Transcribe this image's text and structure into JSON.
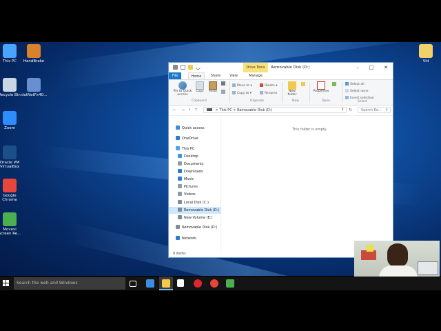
{
  "desktop": {
    "icons_left": [
      {
        "label": "This PC",
        "icon": "this-pc-icon",
        "color": "#4aa3ff"
      },
      {
        "label": "Recycle Bin",
        "icon": "recycle-bin-icon",
        "color": "#c9d6e3"
      },
      {
        "label": "Zoom",
        "icon": "zoom-icon",
        "color": "#2d8cff"
      },
      {
        "label": "Oracle VM VirtualBox",
        "icon": "virtualbox-icon",
        "color": "#1b4f8a"
      },
      {
        "label": "Google Chrome",
        "icon": "chrome-icon",
        "color": "#e8453c"
      },
      {
        "label": "Movavi Screen Re...",
        "icon": "movavi-icon",
        "color": "#4caf50"
      }
    ],
    "icons_second": [
      {
        "label": "HandBrake",
        "icon": "handbrake-icon",
        "color": "#d9822b"
      },
      {
        "label": "dotNetFx40...",
        "icon": "installer-icon",
        "color": "#6a8fd1"
      }
    ],
    "icon_right": {
      "label": "Vid",
      "icon": "folder-icon",
      "color": "#f2d16b"
    }
  },
  "explorer": {
    "context_tab": "Drive Tools",
    "title": "Removable Disk (D:)",
    "tabs": [
      "File",
      "Home",
      "Share",
      "View",
      "Manage"
    ],
    "ribbon": {
      "pin_label": "Pin to Quick access",
      "copy_label": "Copy",
      "paste_label": "Paste",
      "clipboard_group": "Clipboard",
      "move_to": "Move to",
      "copy_to": "Copy to",
      "delete": "Delete",
      "rename": "Rename",
      "organize_group": "Organize",
      "new_folder": "New folder",
      "new_group": "New",
      "properties": "Properties",
      "open_group": "Open",
      "select_all": "Select all",
      "select_none": "Select none",
      "invert_selection": "Invert selection",
      "select_group": "Select"
    },
    "address": {
      "this_pc": "This PC",
      "sep": ">",
      "location": "Removable Disk (D:)"
    },
    "search_placeholder": "Search Re...",
    "nav": [
      {
        "label": "Quick access",
        "icon": "star-icon",
        "color": "#3b8de0"
      },
      {
        "label": "OneDrive",
        "icon": "onedrive-icon",
        "color": "#2b7cd3"
      },
      {
        "label": "This PC",
        "icon": "pc-icon",
        "color": "#4aa3ff"
      },
      {
        "label": "Desktop",
        "icon": "desktop-folder-icon",
        "color": "#3a9ad9"
      },
      {
        "label": "Documents",
        "icon": "documents-icon",
        "color": "#8a9bb0"
      },
      {
        "label": "Downloads",
        "icon": "downloads-icon",
        "color": "#2b7cd3"
      },
      {
        "label": "Music",
        "icon": "music-icon",
        "color": "#2b7cd3"
      },
      {
        "label": "Pictures",
        "icon": "pictures-icon",
        "color": "#8a9bb0"
      },
      {
        "label": "Videos",
        "icon": "videos-icon",
        "color": "#8a9bb0"
      },
      {
        "label": "Local Disk (C:)",
        "icon": "drive-icon",
        "color": "#7f8c99"
      },
      {
        "label": "Removable Disk (D:)",
        "icon": "usb-drive-icon",
        "color": "#7f8c99"
      },
      {
        "label": "New Volume (E:)",
        "icon": "drive-icon",
        "color": "#7f8c99"
      },
      {
        "label": "Removable Disk (D:)",
        "icon": "usb-drive-icon",
        "color": "#7f8c99"
      },
      {
        "label": "Network",
        "icon": "network-icon",
        "color": "#2b7cd3"
      }
    ],
    "empty_message": "This folder is empty.",
    "status": "0 items"
  },
  "taskbar": {
    "search_placeholder": "Search the web and Windows",
    "apps": [
      {
        "name": "task-view-icon",
        "color": "#ffffff"
      },
      {
        "name": "edge-icon",
        "color": "#3c8ee0"
      },
      {
        "name": "file-explorer-icon",
        "color": "#f2c94c"
      },
      {
        "name": "store-icon",
        "color": "#ffffff"
      },
      {
        "name": "opera-icon",
        "color": "#e0262d"
      },
      {
        "name": "chrome-icon",
        "color": "#e8453c"
      },
      {
        "name": "movavi-icon",
        "color": "#4caf50"
      }
    ]
  }
}
